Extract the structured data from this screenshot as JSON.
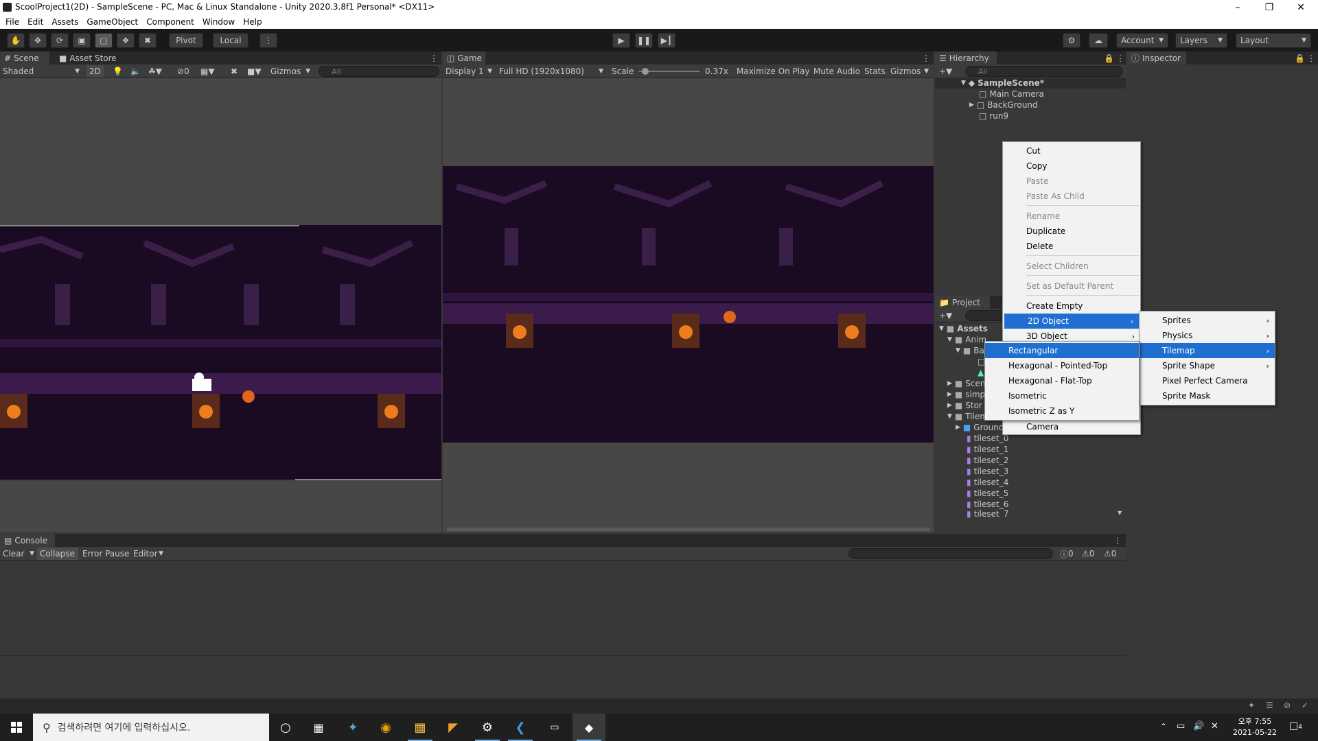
{
  "window": {
    "title": "ScoolProject1(2D) - SampleScene - PC, Mac & Linux Standalone - Unity 2020.3.8f1 Personal* <DX11>"
  },
  "menu": [
    "File",
    "Edit",
    "Assets",
    "GameObject",
    "Component",
    "Window",
    "Help"
  ],
  "toolbar": {
    "pivot": "Pivot",
    "local": "Local",
    "account": "Account",
    "layers": "Layers",
    "layout": "Layout"
  },
  "scene": {
    "tabs": [
      "Scene",
      "Asset Store"
    ],
    "shading": "Shaded",
    "mode_2d": "2D",
    "hidden_count": "0",
    "gizmos": "Gizmos",
    "search_placeholder": "All"
  },
  "game": {
    "tab": "Game",
    "display": "Display 1",
    "resolution": "Full HD (1920x1080)",
    "scale_label": "Scale",
    "scale_value": "0.37x",
    "scale_fraction": 0.1,
    "maximize": "Maximize On Play",
    "mute": "Mute Audio",
    "stats": "Stats",
    "gizmos": "Gizmos"
  },
  "hierarchy": {
    "tab": "Hierarchy",
    "search_placeholder": "All",
    "scene": "SampleScene*",
    "items": [
      "Main Camera",
      "BackGround",
      "run9"
    ]
  },
  "inspector": {
    "tab": "Inspector"
  },
  "project": {
    "tab": "Project",
    "assets_root": "Assets",
    "rows": [
      {
        "label": "Anim"
      },
      {
        "label": "Ba"
      },
      {
        "label": ""
      },
      {
        "label": ""
      },
      {
        "label": "Scen"
      },
      {
        "label": "simp"
      },
      {
        "label": "Stor"
      },
      {
        "label": "Tilem"
      },
      {
        "label": "Ground"
      },
      {
        "label": "tileset_0"
      },
      {
        "label": "tileset_1"
      },
      {
        "label": "tileset_2"
      },
      {
        "label": "tileset_3"
      },
      {
        "label": "tileset_4"
      },
      {
        "label": "tileset_5"
      },
      {
        "label": "tileset_6"
      },
      {
        "label": "tileset_7"
      }
    ]
  },
  "context_menu": {
    "items": [
      {
        "label": "Cut",
        "enabled": true
      },
      {
        "label": "Copy",
        "enabled": true
      },
      {
        "label": "Paste",
        "enabled": false
      },
      {
        "label": "Paste As Child",
        "enabled": false
      },
      {
        "label": "Rename",
        "enabled": false
      },
      {
        "label": "Duplicate",
        "enabled": true
      },
      {
        "label": "Delete",
        "enabled": true
      },
      {
        "label": "Select Children",
        "enabled": false
      },
      {
        "label": "Set as Default Parent",
        "enabled": false
      },
      {
        "label": "Create Empty",
        "enabled": true
      },
      {
        "label": "2D Object",
        "enabled": true
      },
      {
        "label": "3D Object",
        "enabled": true
      },
      {
        "label": "Camera",
        "enabled": true
      }
    ],
    "submenu_2d": [
      "Sprites",
      "Physics",
      "Tilemap",
      "Sprite Shape",
      "Pixel Perfect Camera",
      "Sprite Mask"
    ],
    "submenu_tilemap": [
      "Rectangular",
      "Hexagonal - Pointed-Top",
      "Hexagonal - Flat-Top",
      "Isometric",
      "Isometric Z as Y"
    ]
  },
  "console": {
    "tab": "Console",
    "clear": "Clear",
    "collapse": "Collapse",
    "error_pause": "Error Pause",
    "editor": "Editor",
    "count_log": "0",
    "count_warn": "0",
    "count_error": "0"
  },
  "taskbar": {
    "search_placeholder": "검색하려면 여기에 입력하십시오.",
    "time": "오후 7:55",
    "date": "2021-05-22",
    "notifications": "4"
  }
}
